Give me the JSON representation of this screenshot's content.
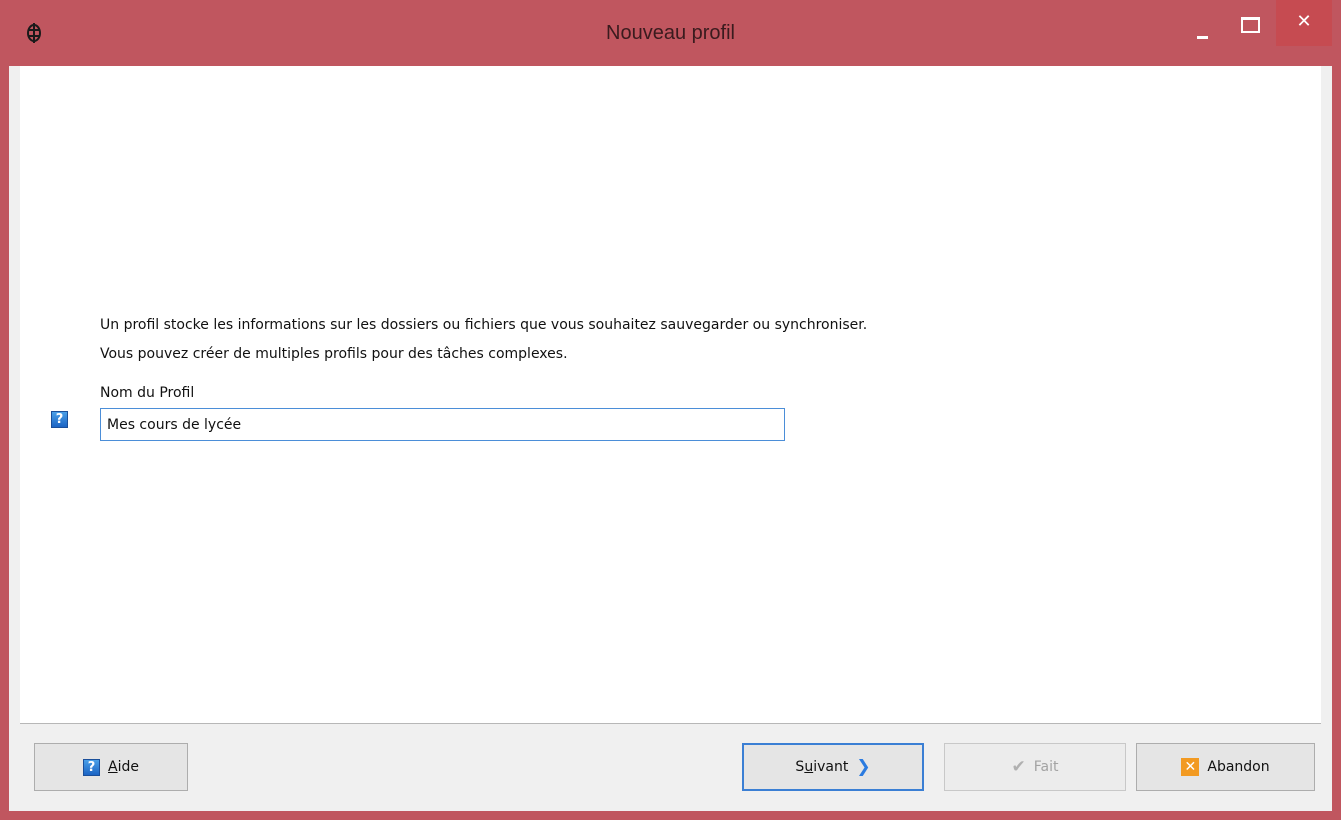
{
  "window": {
    "title": "Nouveau profil",
    "close_glyph": "✕",
    "accent": "#c0565f"
  },
  "content": {
    "description_line1": "Un profil stocke les informations sur les dossiers ou fichiers que vous souhaitez sauvegarder ou synchroniser.",
    "description_line2": "Vous pouvez créer de multiples profils pour des tâches complexes.",
    "field_label": "Nom du Profil",
    "field_value": "Mes cours de lycée",
    "help_glyph": "?"
  },
  "buttons": {
    "help": {
      "prefix": "A",
      "rest": "ide",
      "icon": "help-icon"
    },
    "next": {
      "prefix": "S",
      "underline": "u",
      "rest": "ivant",
      "icon": "chevron-right-icon"
    },
    "done": {
      "label": "Fait",
      "icon": "checkmark-icon"
    },
    "abort": {
      "label": "Abandon",
      "icon": "close-box-icon"
    }
  }
}
